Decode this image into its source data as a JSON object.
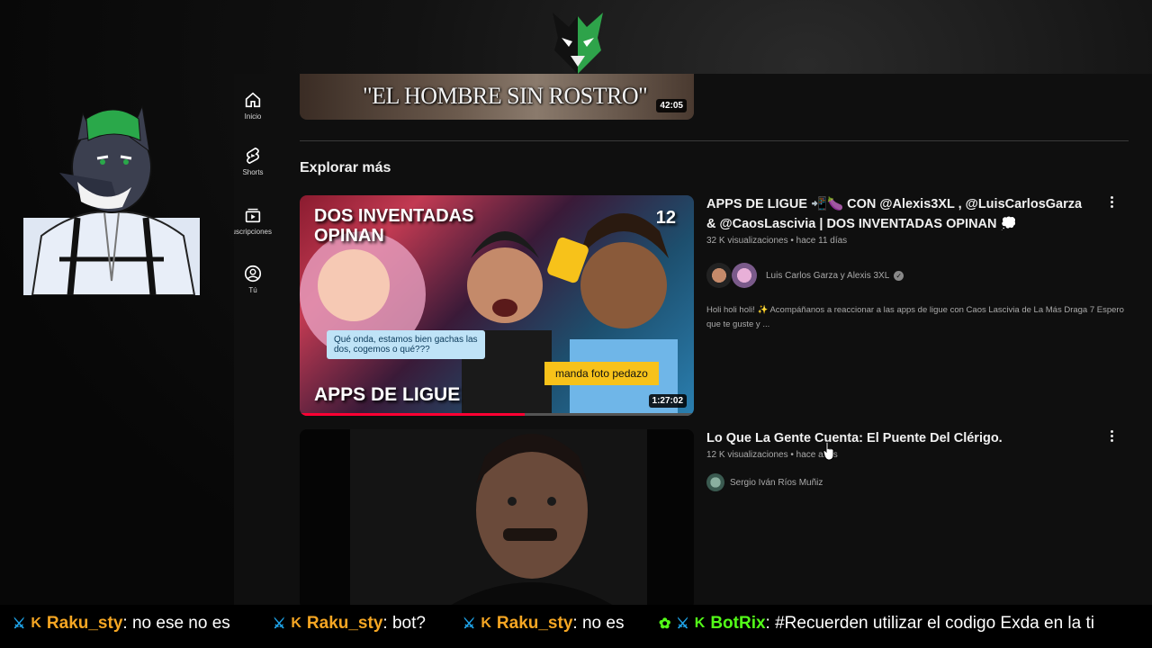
{
  "sidebar": {
    "items": [
      {
        "label": "Inicio",
        "icon": "home-icon"
      },
      {
        "label": "Shorts",
        "icon": "shorts-icon"
      },
      {
        "label": "Suscripciones",
        "icon": "subscriptions-icon"
      },
      {
        "label": "Tú",
        "icon": "you-icon"
      }
    ]
  },
  "top_video": {
    "title_text": "\"EL HOMBRE SIN ROSTRO\"",
    "duration": "42:05"
  },
  "section": {
    "title": "Explorar más"
  },
  "videos": [
    {
      "title": "APPS DE LIGUE 📲🍆 CON @Alexis3XL , @LuisCarlosGarza & @CaosLascivia | DOS INVENTADAS OPINAN 💭",
      "stats": "32 K visualizaciones • hace 11 días",
      "channel": "Luis Carlos Garza y Alexis 3XL",
      "verified": "✓",
      "description": "Holi holi holi! ✨ Acompáñanos a reaccionar a las apps de ligue con Caos Lascivia de La Más Draga 7 Espero que te guste y ...",
      "duration": "1:27:02",
      "progress": 0.57,
      "thumb_text": {
        "headline": "DOS INVENTADAS OPINAN",
        "number": "12",
        "bubble": "Qué onda, estamos bien gachas las dos, cogemos o qué???",
        "tag": "manda foto pedazo",
        "footer": "APPS DE LIGUE"
      }
    },
    {
      "title": "Lo Que La Gente Cuenta: El Puente Del Clérigo.",
      "stats": "12 K visualizaciones • hace años",
      "channel": "Sergio Iván Ríos Muñiz"
    }
  ],
  "chat": [
    {
      "user": "Raku_sty",
      "text": ": no ese no es",
      "color": "#f5a623"
    },
    {
      "user": "Raku_sty",
      "text": ": bot?",
      "color": "#f5a623"
    },
    {
      "user": "Raku_sty",
      "text": ": no es",
      "color": "#f5a623"
    },
    {
      "user": "BotRix",
      "text": ": #Recuerden utilizar el codigo Exda en la ti",
      "color": "#53fc18"
    }
  ],
  "colors": {
    "accent_red": "#ff0033",
    "streamer_green": "#2aa84a",
    "chat_user": "#f5a623",
    "bot": "#53fc18"
  }
}
